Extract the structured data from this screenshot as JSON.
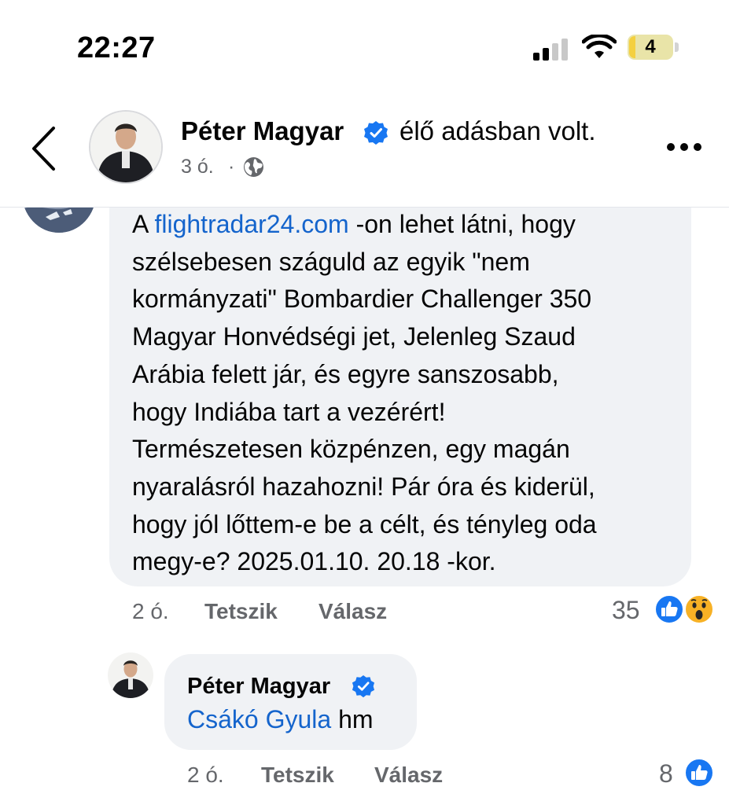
{
  "status_bar": {
    "time": "22:27",
    "battery": "4"
  },
  "header": {
    "name": "Péter Magyar",
    "action": "élő adásban volt.",
    "time": "3 ó.",
    "separator": "·",
    "icons": [
      "back-icon",
      "verified-badge-icon",
      "globe-icon",
      "more-icon"
    ]
  },
  "comment": {
    "link_text": "flightradar24.com",
    "text_lines": [
      " -on lehet látni, hogy",
      "szélsebesen száguld az egyik \"nem",
      "kormányzati\" Bombardier Challenger 350",
      "Magyar Honvédségi jet, Jelenleg Szaud",
      "Arábia felett jár, és egyre sanszosabb,",
      "hogy Indiába tart a vezérért!",
      "Természetesen közpénzen, egy magán",
      "nyaralásról hazahozni! Pár óra és kiderül,",
      "hogy jól lőttem-e be a célt, és tényleg oda",
      "megy-e? 2025.01.10. 20.18 -kor."
    ],
    "prefix": "A ",
    "time": "2 ó.",
    "like_label": "Tetszik",
    "reply_label": "Válasz",
    "reaction_count": "35",
    "reactions": [
      "like-icon",
      "wow-icon"
    ]
  },
  "reply": {
    "name": "Péter Magyar",
    "mention": "Csákó Gyula",
    "text": " hm",
    "time": "2 ó.",
    "like_label": "Tetszik",
    "reply_label": "Válasz",
    "reaction_count": "8",
    "reactions": [
      "like-icon"
    ]
  },
  "colors": {
    "link": "#1464cc",
    "verified": "#1877f2",
    "like": "#1877f2",
    "bubble": "#f0f2f5",
    "meta": "#65676b"
  }
}
